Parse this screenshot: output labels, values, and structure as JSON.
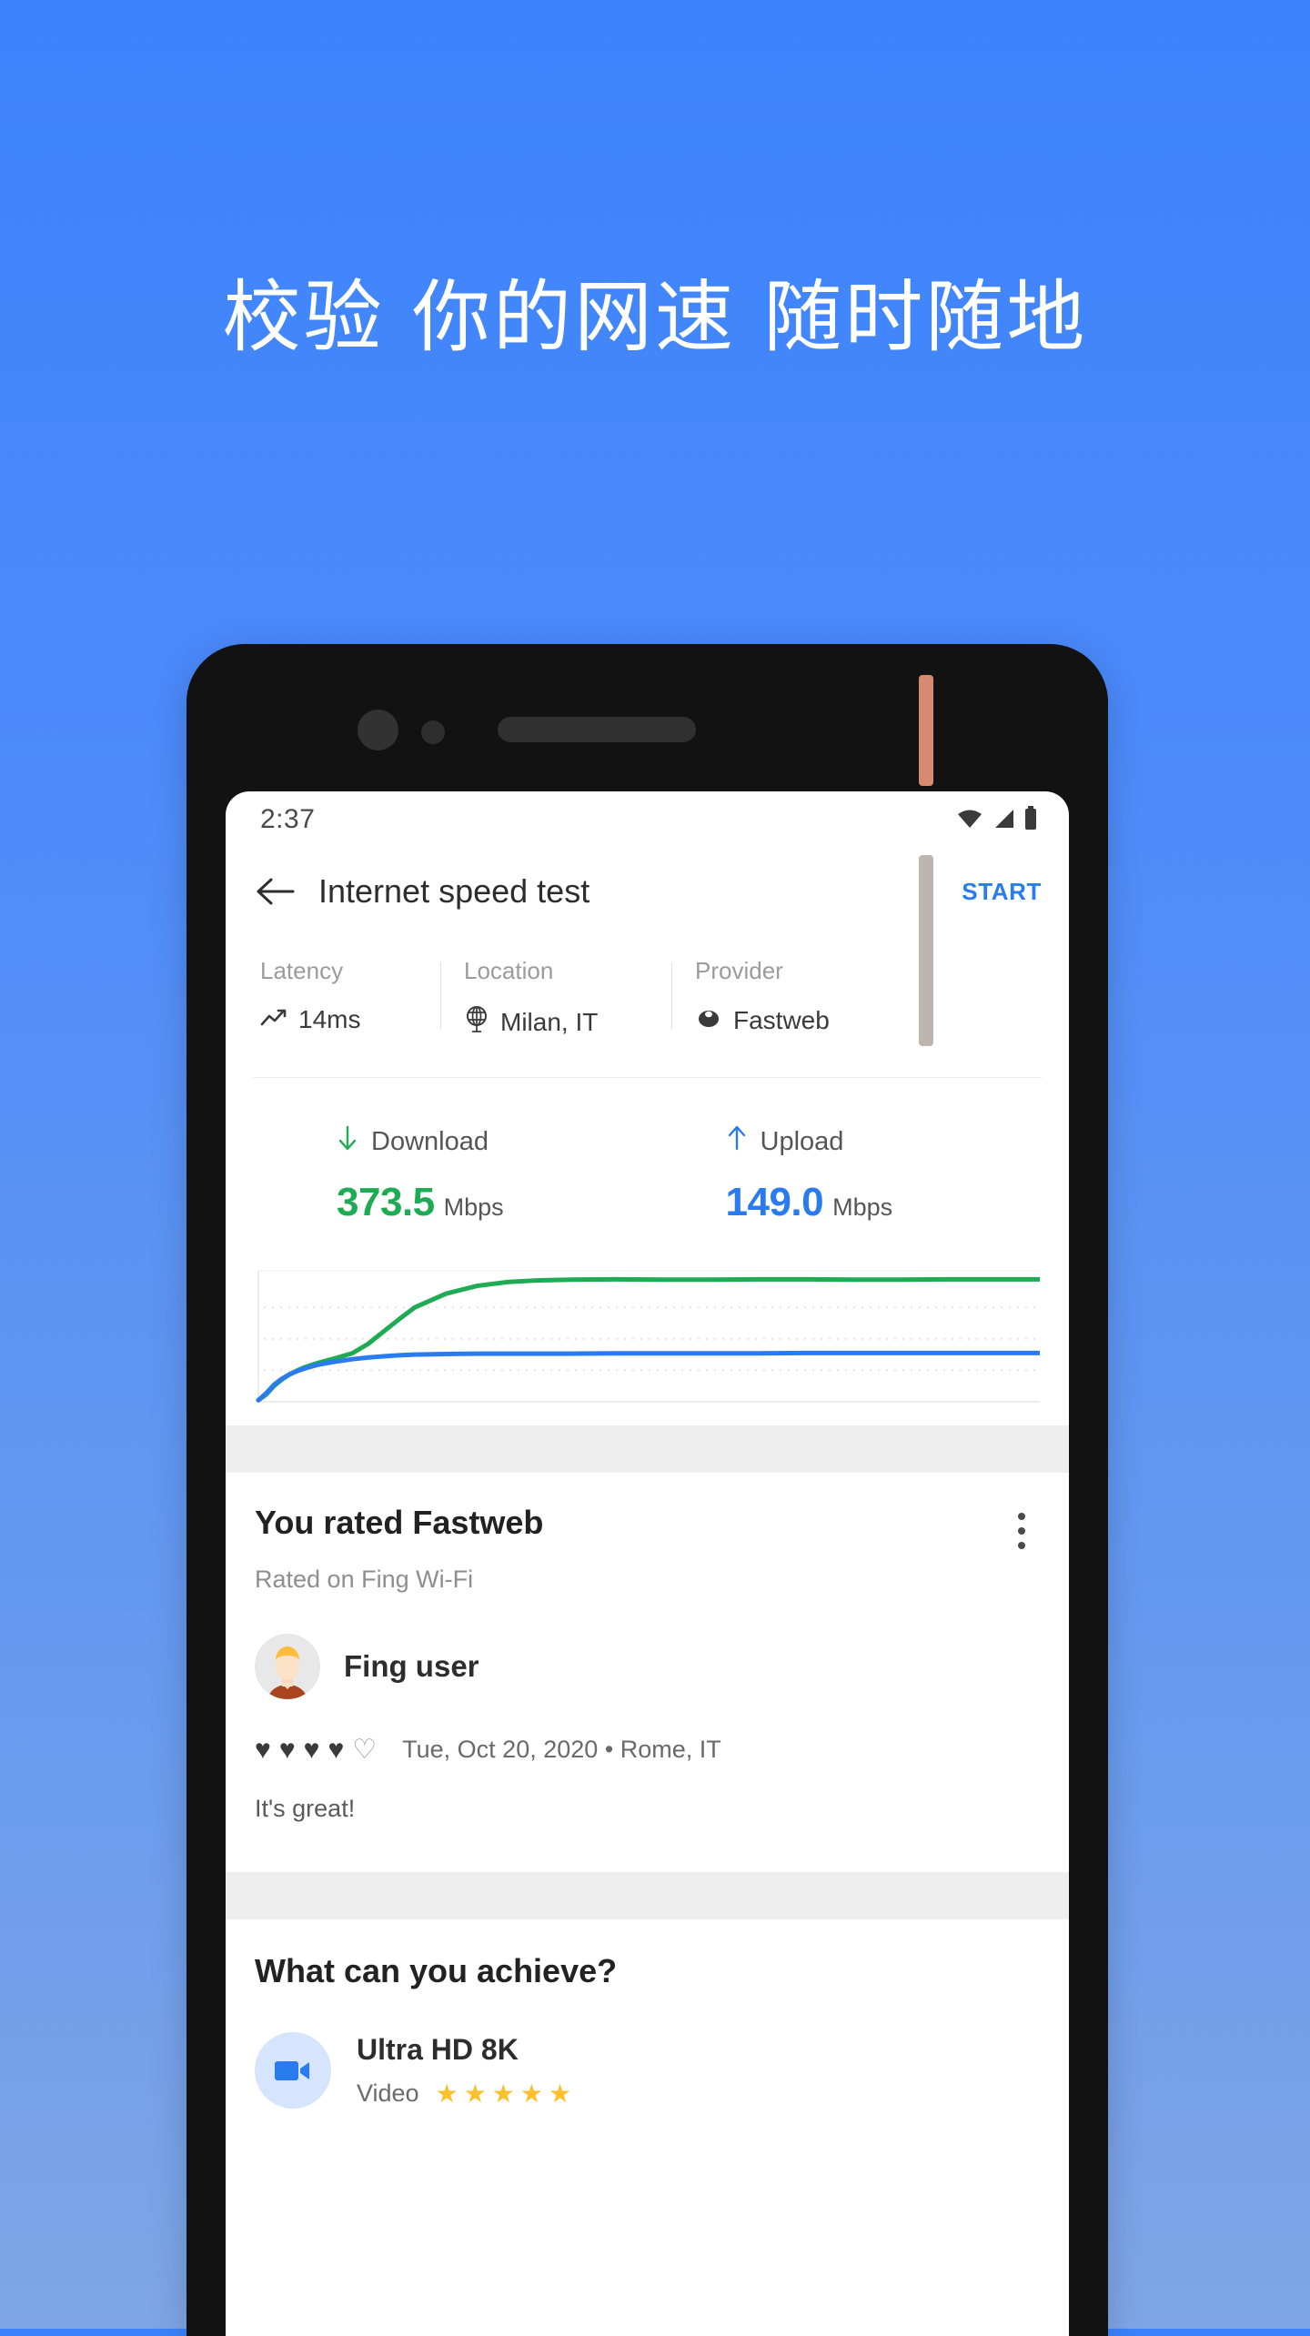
{
  "hero": {
    "headline": "校验 你的网速 随时随地"
  },
  "statusbar": {
    "time": "2:37",
    "wifi_icon": "wifi-icon",
    "signal_icon": "signal-icon",
    "battery_icon": "battery-icon"
  },
  "appbar": {
    "back_icon": "back-arrow-icon",
    "title": "Internet speed test",
    "start_label": "START"
  },
  "stats": [
    {
      "label": "Latency",
      "value": "14ms",
      "icon": "trending-up-icon"
    },
    {
      "label": "Location",
      "value": "Milan, IT",
      "icon": "globe-icon"
    },
    {
      "label": "Provider",
      "value": "Fastweb",
      "icon": "provider-icon"
    }
  ],
  "speeds": {
    "download": {
      "icon": "arrow-down-icon",
      "label": "Download",
      "value": "373.5",
      "unit": "Mbps",
      "color": "#1faa54"
    },
    "upload": {
      "icon": "arrow-up-icon",
      "label": "Upload",
      "value": "149.0",
      "unit": "Mbps",
      "color": "#2a7bf0"
    }
  },
  "chart_data": {
    "type": "line",
    "title": "",
    "xlabel": "",
    "ylabel": "",
    "grid": true,
    "gridlines": [
      0.28,
      0.52,
      0.76
    ],
    "legend": "none",
    "xlim": [
      0,
      100
    ],
    "ylim": [
      0,
      400
    ],
    "series": [
      {
        "name": "Download",
        "color": "#1faa54",
        "x": [
          0,
          1,
          2,
          3,
          4,
          5,
          6,
          7,
          8,
          10,
          12,
          14,
          16,
          18,
          20,
          24,
          28,
          32,
          36,
          40,
          46,
          52,
          58,
          64,
          70,
          76,
          82,
          88,
          94,
          100
        ],
        "values": [
          5,
          22,
          48,
          68,
          84,
          96,
          106,
          114,
          121,
          134,
          148,
          176,
          214,
          252,
          288,
          330,
          354,
          366,
          371,
          373,
          374,
          373,
          373,
          374,
          374,
          373,
          373,
          374,
          374,
          374
        ]
      },
      {
        "name": "Upload",
        "color": "#2a7bf0",
        "x": [
          0,
          1,
          2,
          3,
          4,
          5,
          6,
          7,
          8,
          10,
          12,
          14,
          16,
          18,
          20,
          24,
          28,
          32,
          36,
          40,
          46,
          52,
          58,
          64,
          70,
          76,
          82,
          88,
          94,
          100
        ],
        "values": [
          5,
          26,
          52,
          70,
          84,
          94,
          102,
          109,
          115,
          123,
          130,
          135,
          139,
          142,
          144,
          146,
          147,
          147,
          147,
          147,
          148,
          148,
          148,
          148,
          149,
          149,
          149,
          149,
          149,
          149
        ]
      }
    ]
  },
  "rating_card": {
    "title": "You rated Fastweb",
    "subtitle": "Rated on Fing Wi-Fi",
    "menu_icon": "kebab-menu-icon",
    "user": {
      "name": "Fing user",
      "avatar_icon": "avatar"
    },
    "hearts_filled": 4,
    "hearts_total": 5,
    "meta": "Tue, Oct 20, 2020 • Rome, IT",
    "comment": "It's great!"
  },
  "achieve": {
    "title": "What can you achieve?",
    "items": [
      {
        "icon": "video-camera-icon",
        "name": "Ultra HD 8K",
        "label": "Video",
        "stars": 5
      }
    ]
  },
  "colors": {
    "bg_top": "#3b82fc",
    "bg_bottom": "#7ea6e6",
    "accent_blue": "#2a7bf0",
    "accent_green": "#1faa54",
    "phone_frame": "#121212",
    "band_gray": "#eeeeee",
    "star_yellow": "#fbc02d",
    "power_button": "#d78b6e",
    "volume_button": "#bdb5ae"
  }
}
